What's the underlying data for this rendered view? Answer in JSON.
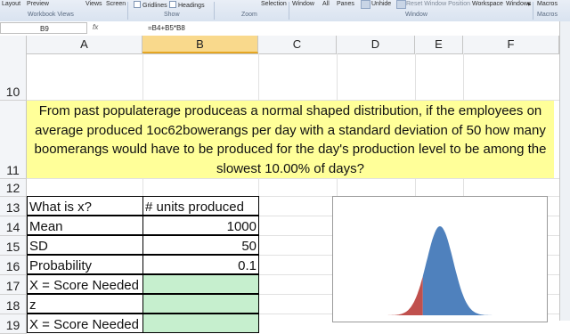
{
  "ribbon": {
    "buttons": [
      {
        "label": "Layout",
        "name": "page-layout-view-button"
      },
      {
        "label": "Preview",
        "name": "page-break-preview-button"
      },
      {
        "label": "Views",
        "name": "custom-views-button"
      },
      {
        "label": "Screen",
        "name": "full-screen-button"
      },
      {
        "label": "Gridlines",
        "name": "gridlines-checkbox"
      },
      {
        "label": "Headings",
        "name": "headings-checkbox"
      },
      {
        "label": "Selection",
        "name": "zoom-to-selection-button"
      },
      {
        "label": "Window",
        "name": "new-window-button"
      },
      {
        "label": "All",
        "name": "arrange-all-button"
      },
      {
        "label": "Panes",
        "name": "freeze-panes-button"
      },
      {
        "label": "Unhide",
        "name": "unhide-button"
      },
      {
        "label": "Reset Window Position",
        "name": "reset-window-position-button"
      },
      {
        "label": "Workspace",
        "name": "save-workspace-button"
      },
      {
        "label": "Windows",
        "name": "switch-windows-button"
      },
      {
        "label": "Macros",
        "name": "macros-button"
      }
    ],
    "groups": [
      "Workbook Views",
      "Show",
      "Zoom",
      "Window",
      "Macros"
    ]
  },
  "formula_bar": {
    "cell_ref": "B9",
    "fx": "fx",
    "formula": "=B4+B5*B8"
  },
  "columns": [
    "A",
    "B",
    "C",
    "D",
    "E",
    "F"
  ],
  "rows": [
    "10",
    "11",
    "12",
    "13",
    "14",
    "15",
    "16",
    "17",
    "18",
    "19"
  ],
  "question": "From past populaterage produceas a normal shaped distribution, if the employees on average produced 1oc62bowerangs per day with a standard deviation of 50 how many boomerangs would have to be produced for the day's production level to be among the slowest 10.00% of days?",
  "table": {
    "r13": {
      "a": "What is x?",
      "b": "# units produced"
    },
    "r14": {
      "a": "Mean",
      "b": "1000"
    },
    "r15": {
      "a": "SD",
      "b": "50"
    },
    "r16": {
      "a": "Probability",
      "b": "0.1"
    },
    "r17": {
      "a": "X = Score Needed",
      "b": ""
    },
    "r18": {
      "a": "z",
      "b": ""
    },
    "r19": {
      "a": "X = Score Needed",
      "b": ""
    }
  },
  "colors": {
    "question_fill": "#ffff99",
    "answer_fill": "#c6efce",
    "curve_blue": "#4f81bd",
    "tail_red": "#c0504d",
    "selected_header": "#f9d98c"
  }
}
